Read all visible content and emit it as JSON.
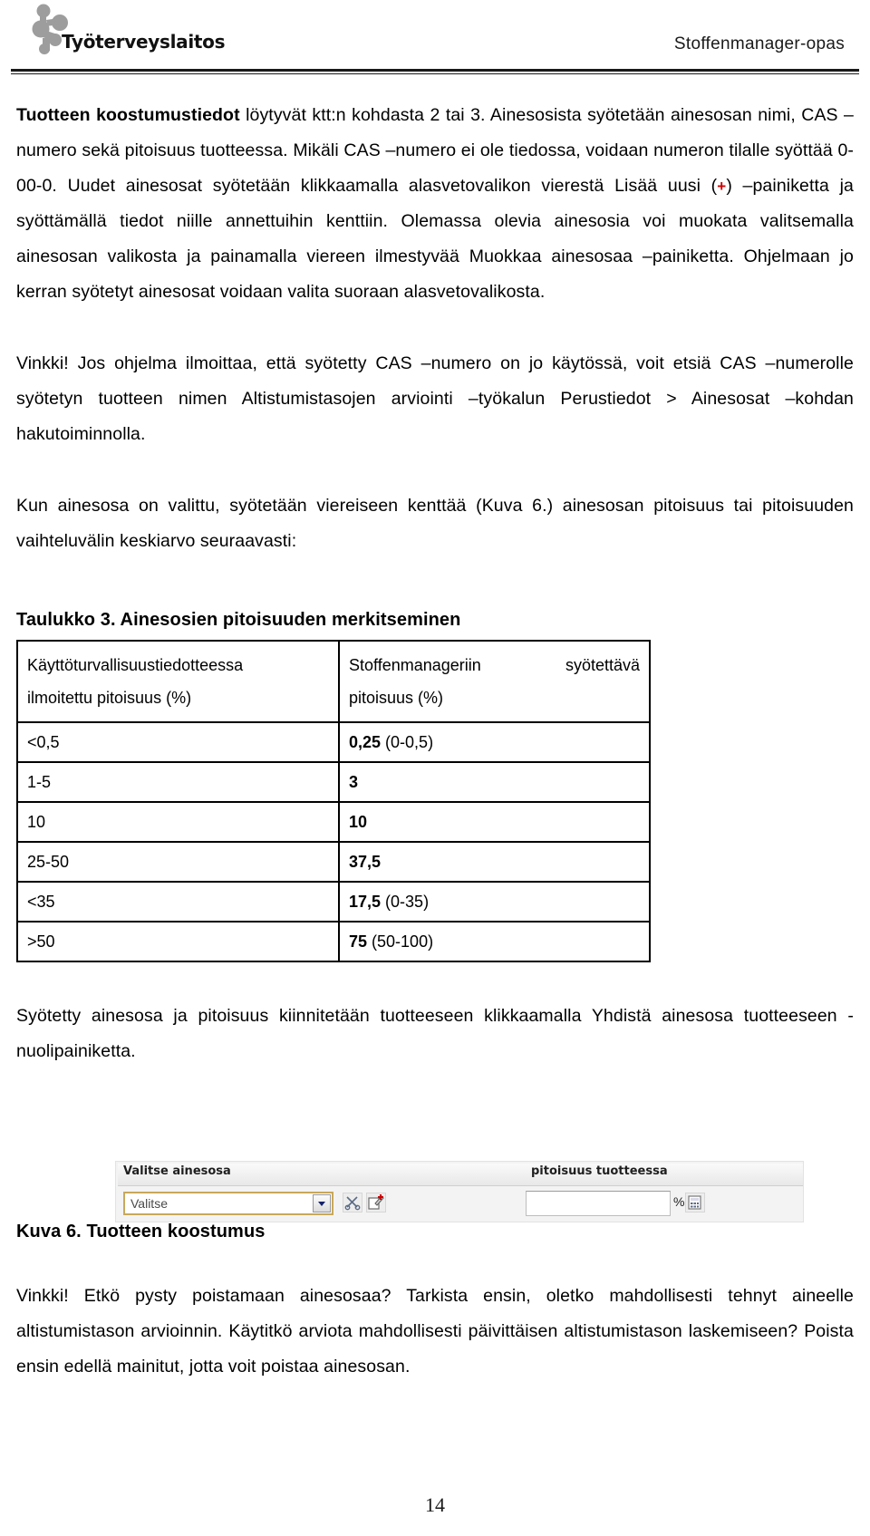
{
  "header": {
    "logo_icon": "molecule-logo-icon",
    "logo_wordmark": "Työterveyslaitos",
    "document_title": "Stoffenmanager-opas"
  },
  "body": {
    "para1_lead": "Tuotteen koostumustiedot",
    "para1_a": " löytyvät ktt:n kohdasta 2 tai 3. Ainesosista syötetään ainesosan nimi, CAS –numero sekä pitoisuus tuotteessa. Mikäli CAS –numero ei ole tiedossa, voidaan numeron tilalle syöttää 0-00-0. Uudet ainesosat syötetään klikkaamalla alasvetovalikon vierestä Lisää uusi (",
    "para1_plus": "+",
    "para1_b": ") –painiketta ja syöttämällä tiedot niille annettuihin kenttiin. Olemassa olevia ainesosia voi muokata valitsemalla ainesosan valikosta ja painamalla viereen ilmestyvää Muokkaa ainesosaa –painiketta. Ohjelmaan jo kerran syötetyt ainesosat voidaan valita suoraan alasvetovalikosta.",
    "para2": "Vinkki! Jos ohjelma ilmoittaa, että syötetty CAS –numero on jo käytössä, voit etsiä CAS –numerolle syötetyn tuotteen nimen Altistumistasojen arviointi –työkalun Perustiedot > Ainesosat –kohdan hakutoiminnolla.",
    "para3": "Kun ainesosa on valittu, syötetään viereiseen kenttää (Kuva 6.) ainesosan pitoisuus tai pitoisuuden vaihteluvälin keskiarvo seuraavasti:",
    "para4": "Syötetty ainesosa ja pitoisuus kiinnitetään tuotteeseen klikkaamalla Yhdistä ainesosa tuotteeseen -nuolipainiketta.",
    "para5": "Vinkki! Etkö pysty poistamaan ainesosaa? Tarkista ensin, oletko mahdollisesti tehnyt aineelle altistumistason arvioinnin. Käytitkö arviota mahdollisesti päivittäisen altistumistason laskemiseen? Poista ensin edellä mainitut, jotta voit poistaa ainesosan."
  },
  "table": {
    "caption": "Taulukko 3. Ainesosien pitoisuuden merkitseminen",
    "headers": [
      "Käyttöturvallisuustiedotteessa ilmoitettu pitoisuus (%)",
      "Stoffenmanageriin syötettävä pitoisuus (%)"
    ],
    "header_lines": {
      "col1_line1": "Käyttöturvallisuustiedotteessa",
      "col1_line2": "ilmoitettu pitoisuus (%)",
      "col2_line1": "Stoffenmanageriin syötettävä",
      "col2_line2": "pitoisuus (%)"
    },
    "rows": [
      {
        "declared": "<0,5",
        "value_bold": "0,25",
        "value_rest": " (0-0,5)"
      },
      {
        "declared": "1-5",
        "value_bold": "3",
        "value_rest": ""
      },
      {
        "declared": "10",
        "value_bold": "10",
        "value_rest": ""
      },
      {
        "declared": "25-50",
        "value_bold": "37,5",
        "value_rest": ""
      },
      {
        "declared": "<35",
        "value_bold": "17,5",
        "value_rest": " (0-35)"
      },
      {
        "declared": ">50",
        "value_bold": "75",
        "value_rest": " (50-100)"
      }
    ]
  },
  "figure": {
    "screenshot": {
      "label_left": "Valitse ainesosa",
      "label_right": "pitoisuus tuotteessa",
      "select_value": "Valitse",
      "select_arrow_icon": "chevron-down-icon",
      "icon_scissors": "scissors-icon",
      "icon_edit": "edit-pencil-icon",
      "icon_calculator": "calculator-icon",
      "concentration_value": "",
      "percent_sign": "%"
    },
    "caption": "Kuva 6. Tuotteen koostumus"
  },
  "footer": {
    "page_number": "14"
  },
  "colors": {
    "accent_red": "#d00000",
    "select_border": "#c8a85a",
    "rule": "#1a1a1a"
  }
}
